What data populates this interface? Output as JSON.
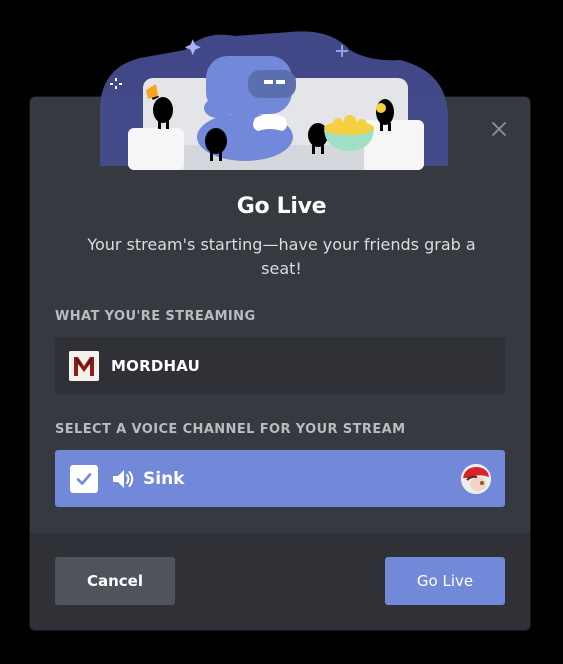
{
  "dialog": {
    "title": "Go Live",
    "subtitle": "Your stream's starting—have your friends grab a seat!"
  },
  "streaming": {
    "label": "WHAT YOU'RE STREAMING",
    "game_name": "MORDHAU",
    "game_icon": "mordhau-logo-icon"
  },
  "voice_channel": {
    "label": "SELECT A VOICE CHANNEL FOR YOUR STREAM",
    "channel_name": "Sink",
    "selected": true,
    "icon": "speaker-icon"
  },
  "buttons": {
    "cancel_label": "Cancel",
    "go_live_label": "Go Live"
  },
  "colors": {
    "accent": "#7289da",
    "modal_bg": "#36393f",
    "footer_bg": "#2f3136",
    "secondary_button": "#4f545c"
  }
}
